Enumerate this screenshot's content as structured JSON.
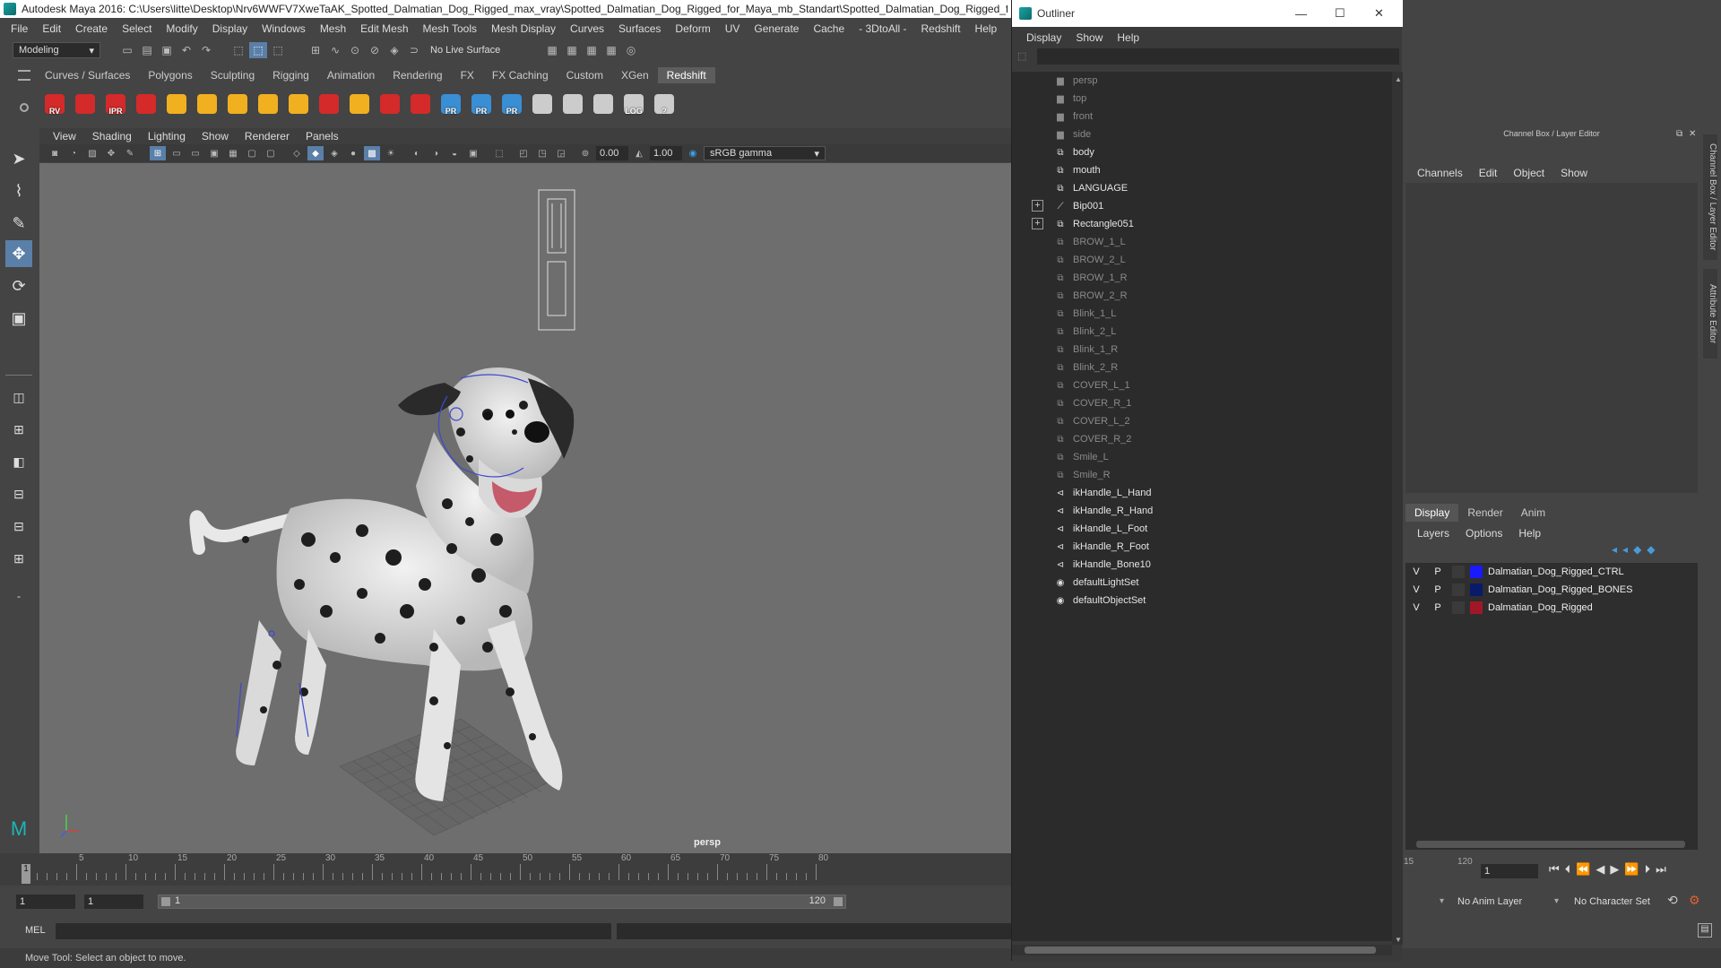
{
  "window": {
    "title": "Autodesk Maya 2016: C:\\Users\\litte\\Desktop\\Nrv6WWFV7XweTaAK_Spotted_Dalmatian_Dog_Rigged_max_vray\\Spotted_Dalmatian_Dog_Rigged_for_Maya_mb_Standart\\Spotted_Dalmatian_Dog_Rigged_for_Maya",
    "minimize": "—",
    "maximize": "❐",
    "close": "✕"
  },
  "menubar": [
    "File",
    "Edit",
    "Create",
    "Select",
    "Modify",
    "Display",
    "Windows",
    "Mesh",
    "Edit Mesh",
    "Mesh Tools",
    "Mesh Display",
    "Curves",
    "Surfaces",
    "Deform",
    "UV",
    "Generate",
    "Cache",
    "- 3DtoAll -",
    "Redshift",
    "Help"
  ],
  "statusline": {
    "mode": "Modeling",
    "live_surface": "No Live Surface"
  },
  "shelf_tabs": [
    "Curves / Surfaces",
    "Polygons",
    "Sculpting",
    "Rigging",
    "Animation",
    "Rendering",
    "FX",
    "FX Caching",
    "Custom",
    "XGen",
    "Redshift"
  ],
  "shelf_active": "Redshift",
  "shelf_icons": [
    {
      "name": "rv-icon",
      "label": "RV",
      "color": "#d42a2a"
    },
    {
      "name": "render-icon",
      "label": "",
      "color": "#d42a2a"
    },
    {
      "name": "ipr-icon",
      "label": "IPR",
      "color": "#d42a2a"
    },
    {
      "name": "render-settings-icon",
      "label": "",
      "color": "#d42a2a"
    },
    {
      "name": "light-icon",
      "label": "",
      "color": "#f0b020"
    },
    {
      "name": "grid-light-icon",
      "label": "",
      "color": "#f0b020"
    },
    {
      "name": "spot-light-icon",
      "label": "",
      "color": "#f0b020"
    },
    {
      "name": "dome-light-icon",
      "label": "",
      "color": "#f0b020"
    },
    {
      "name": "sun-icon",
      "label": "",
      "color": "#f0b020"
    },
    {
      "name": "box-icon",
      "label": "",
      "color": "#d42a2a"
    },
    {
      "name": "sky-icon",
      "label": "",
      "color": "#f0b020"
    },
    {
      "name": "hair-icon",
      "label": "",
      "color": "#d42a2a"
    },
    {
      "name": "sphere-icon",
      "label": "",
      "color": "#d42a2a"
    },
    {
      "name": "pr-1-icon",
      "label": "PR",
      "color": "#3a8ed4"
    },
    {
      "name": "pr-2-icon",
      "label": "PR",
      "color": "#3a8ed4"
    },
    {
      "name": "pr-3-icon",
      "label": "PR",
      "color": "#3a8ed4"
    },
    {
      "name": "bowl-1-icon",
      "label": "",
      "color": "#cccccc"
    },
    {
      "name": "bowl-2-icon",
      "label": "",
      "color": "#cccccc"
    },
    {
      "name": "window-icon",
      "label": "",
      "color": "#cccccc"
    },
    {
      "name": "log-icon",
      "label": "LOG",
      "color": "#cccccc"
    },
    {
      "name": "help-icon",
      "label": "?",
      "color": "#cccccc"
    }
  ],
  "viewport": {
    "menu": [
      "View",
      "Shading",
      "Lighting",
      "Show",
      "Renderer",
      "Panels"
    ],
    "exposure": "0.00",
    "gamma": "1.00",
    "colorspace": "sRGB gamma",
    "camera": "persp"
  },
  "timeline": {
    "ticks": [
      "5",
      "10",
      "15",
      "20",
      "25",
      "30",
      "35",
      "40",
      "45",
      "50",
      "55",
      "60",
      "65",
      "70",
      "75",
      "80"
    ],
    "current_marker": "1"
  },
  "range": {
    "start": "1",
    "current": "1",
    "slider_start": "1",
    "slider_end": "120",
    "right_start": "15",
    "right_end": "120",
    "frame": "1",
    "anim_layer": "No Anim Layer",
    "character_set": "No Character Set"
  },
  "cmdline": {
    "label": "MEL"
  },
  "helpline": "Move Tool: Select an object to move.",
  "outliner": {
    "title": "Outliner",
    "menu": [
      "Display",
      "Show",
      "Help"
    ],
    "items": [
      {
        "label": "persp",
        "icon": "camera-icon",
        "glyph": "▆",
        "dim": true,
        "expand": false
      },
      {
        "label": "top",
        "icon": "camera-icon",
        "glyph": "▆",
        "dim": true,
        "expand": false
      },
      {
        "label": "front",
        "icon": "camera-icon",
        "glyph": "▆",
        "dim": true,
        "expand": false
      },
      {
        "label": "side",
        "icon": "camera-icon",
        "glyph": "▆",
        "dim": true,
        "expand": false
      },
      {
        "label": "body",
        "icon": "mesh-icon",
        "glyph": "⧉",
        "dim": false,
        "expand": false
      },
      {
        "label": "mouth",
        "icon": "mesh-icon",
        "glyph": "⧉",
        "dim": false,
        "expand": false
      },
      {
        "label": "LANGUAGE",
        "icon": "mesh-icon",
        "glyph": "⧉",
        "dim": false,
        "expand": false
      },
      {
        "label": "Bip001",
        "icon": "joint-icon",
        "glyph": "⟋",
        "dim": false,
        "expand": true
      },
      {
        "label": "Rectangle051",
        "icon": "mesh-icon",
        "glyph": "⧉",
        "dim": false,
        "expand": true
      },
      {
        "label": "BROW_1_L",
        "icon": "mesh-icon",
        "glyph": "⧉",
        "dim": true,
        "expand": false
      },
      {
        "label": "BROW_2_L",
        "icon": "mesh-icon",
        "glyph": "⧉",
        "dim": true,
        "expand": false
      },
      {
        "label": "BROW_1_R",
        "icon": "mesh-icon",
        "glyph": "⧉",
        "dim": true,
        "expand": false
      },
      {
        "label": "BROW_2_R",
        "icon": "mesh-icon",
        "glyph": "⧉",
        "dim": true,
        "expand": false
      },
      {
        "label": "Blink_1_L",
        "icon": "mesh-icon",
        "glyph": "⧉",
        "dim": true,
        "expand": false
      },
      {
        "label": "Blink_2_L",
        "icon": "mesh-icon",
        "glyph": "⧉",
        "dim": true,
        "expand": false
      },
      {
        "label": "Blink_1_R",
        "icon": "mesh-icon",
        "glyph": "⧉",
        "dim": true,
        "expand": false
      },
      {
        "label": "Blink_2_R",
        "icon": "mesh-icon",
        "glyph": "⧉",
        "dim": true,
        "expand": false
      },
      {
        "label": "COVER_L_1",
        "icon": "mesh-icon",
        "glyph": "⧉",
        "dim": true,
        "expand": false
      },
      {
        "label": "COVER_R_1",
        "icon": "mesh-icon",
        "glyph": "⧉",
        "dim": true,
        "expand": false
      },
      {
        "label": "COVER_L_2",
        "icon": "mesh-icon",
        "glyph": "⧉",
        "dim": true,
        "expand": false
      },
      {
        "label": "COVER_R_2",
        "icon": "mesh-icon",
        "glyph": "⧉",
        "dim": true,
        "expand": false
      },
      {
        "label": "Smile_L",
        "icon": "mesh-icon",
        "glyph": "⧉",
        "dim": true,
        "expand": false
      },
      {
        "label": "Smile_R",
        "icon": "mesh-icon",
        "glyph": "⧉",
        "dim": true,
        "expand": false
      },
      {
        "label": "ikHandle_L_Hand",
        "icon": "ik-handle-icon",
        "glyph": "⊲",
        "dim": false,
        "expand": false
      },
      {
        "label": "ikHandle_R_Hand",
        "icon": "ik-handle-icon",
        "glyph": "⊲",
        "dim": false,
        "expand": false
      },
      {
        "label": "ikHandle_L_Foot",
        "icon": "ik-handle-icon",
        "glyph": "⊲",
        "dim": false,
        "expand": false
      },
      {
        "label": "ikHandle_R_Foot",
        "icon": "ik-handle-icon",
        "glyph": "⊲",
        "dim": false,
        "expand": false
      },
      {
        "label": "ikHandle_Bone10",
        "icon": "ik-handle-icon",
        "glyph": "⊲",
        "dim": false,
        "expand": false
      },
      {
        "label": "defaultLightSet",
        "icon": "set-icon",
        "glyph": "◉",
        "dim": false,
        "expand": false
      },
      {
        "label": "defaultObjectSet",
        "icon": "set-icon",
        "glyph": "◉",
        "dim": false,
        "expand": false
      }
    ]
  },
  "channelbox": {
    "title": "Channel Box / Layer Editor",
    "menu": [
      "Channels",
      "Edit",
      "Object",
      "Show"
    ]
  },
  "layers": {
    "tabs": [
      "Display",
      "Render",
      "Anim"
    ],
    "active": "Display",
    "menu": [
      "Layers",
      "Options",
      "Help"
    ],
    "rows": [
      {
        "v": "V",
        "p": "P",
        "name": "Dalmatian_Dog_Rigged_CTRL",
        "color": "#1a1aff"
      },
      {
        "v": "V",
        "p": "P",
        "name": "Dalmatian_Dog_Rigged_BONES",
        "color": "#0a1a6a"
      },
      {
        "v": "V",
        "p": "P",
        "name": "Dalmatian_Dog_Rigged",
        "color": "#a01828"
      }
    ]
  },
  "side_tabs": [
    "Channel Box / Layer Editor",
    "Attribute Editor"
  ]
}
